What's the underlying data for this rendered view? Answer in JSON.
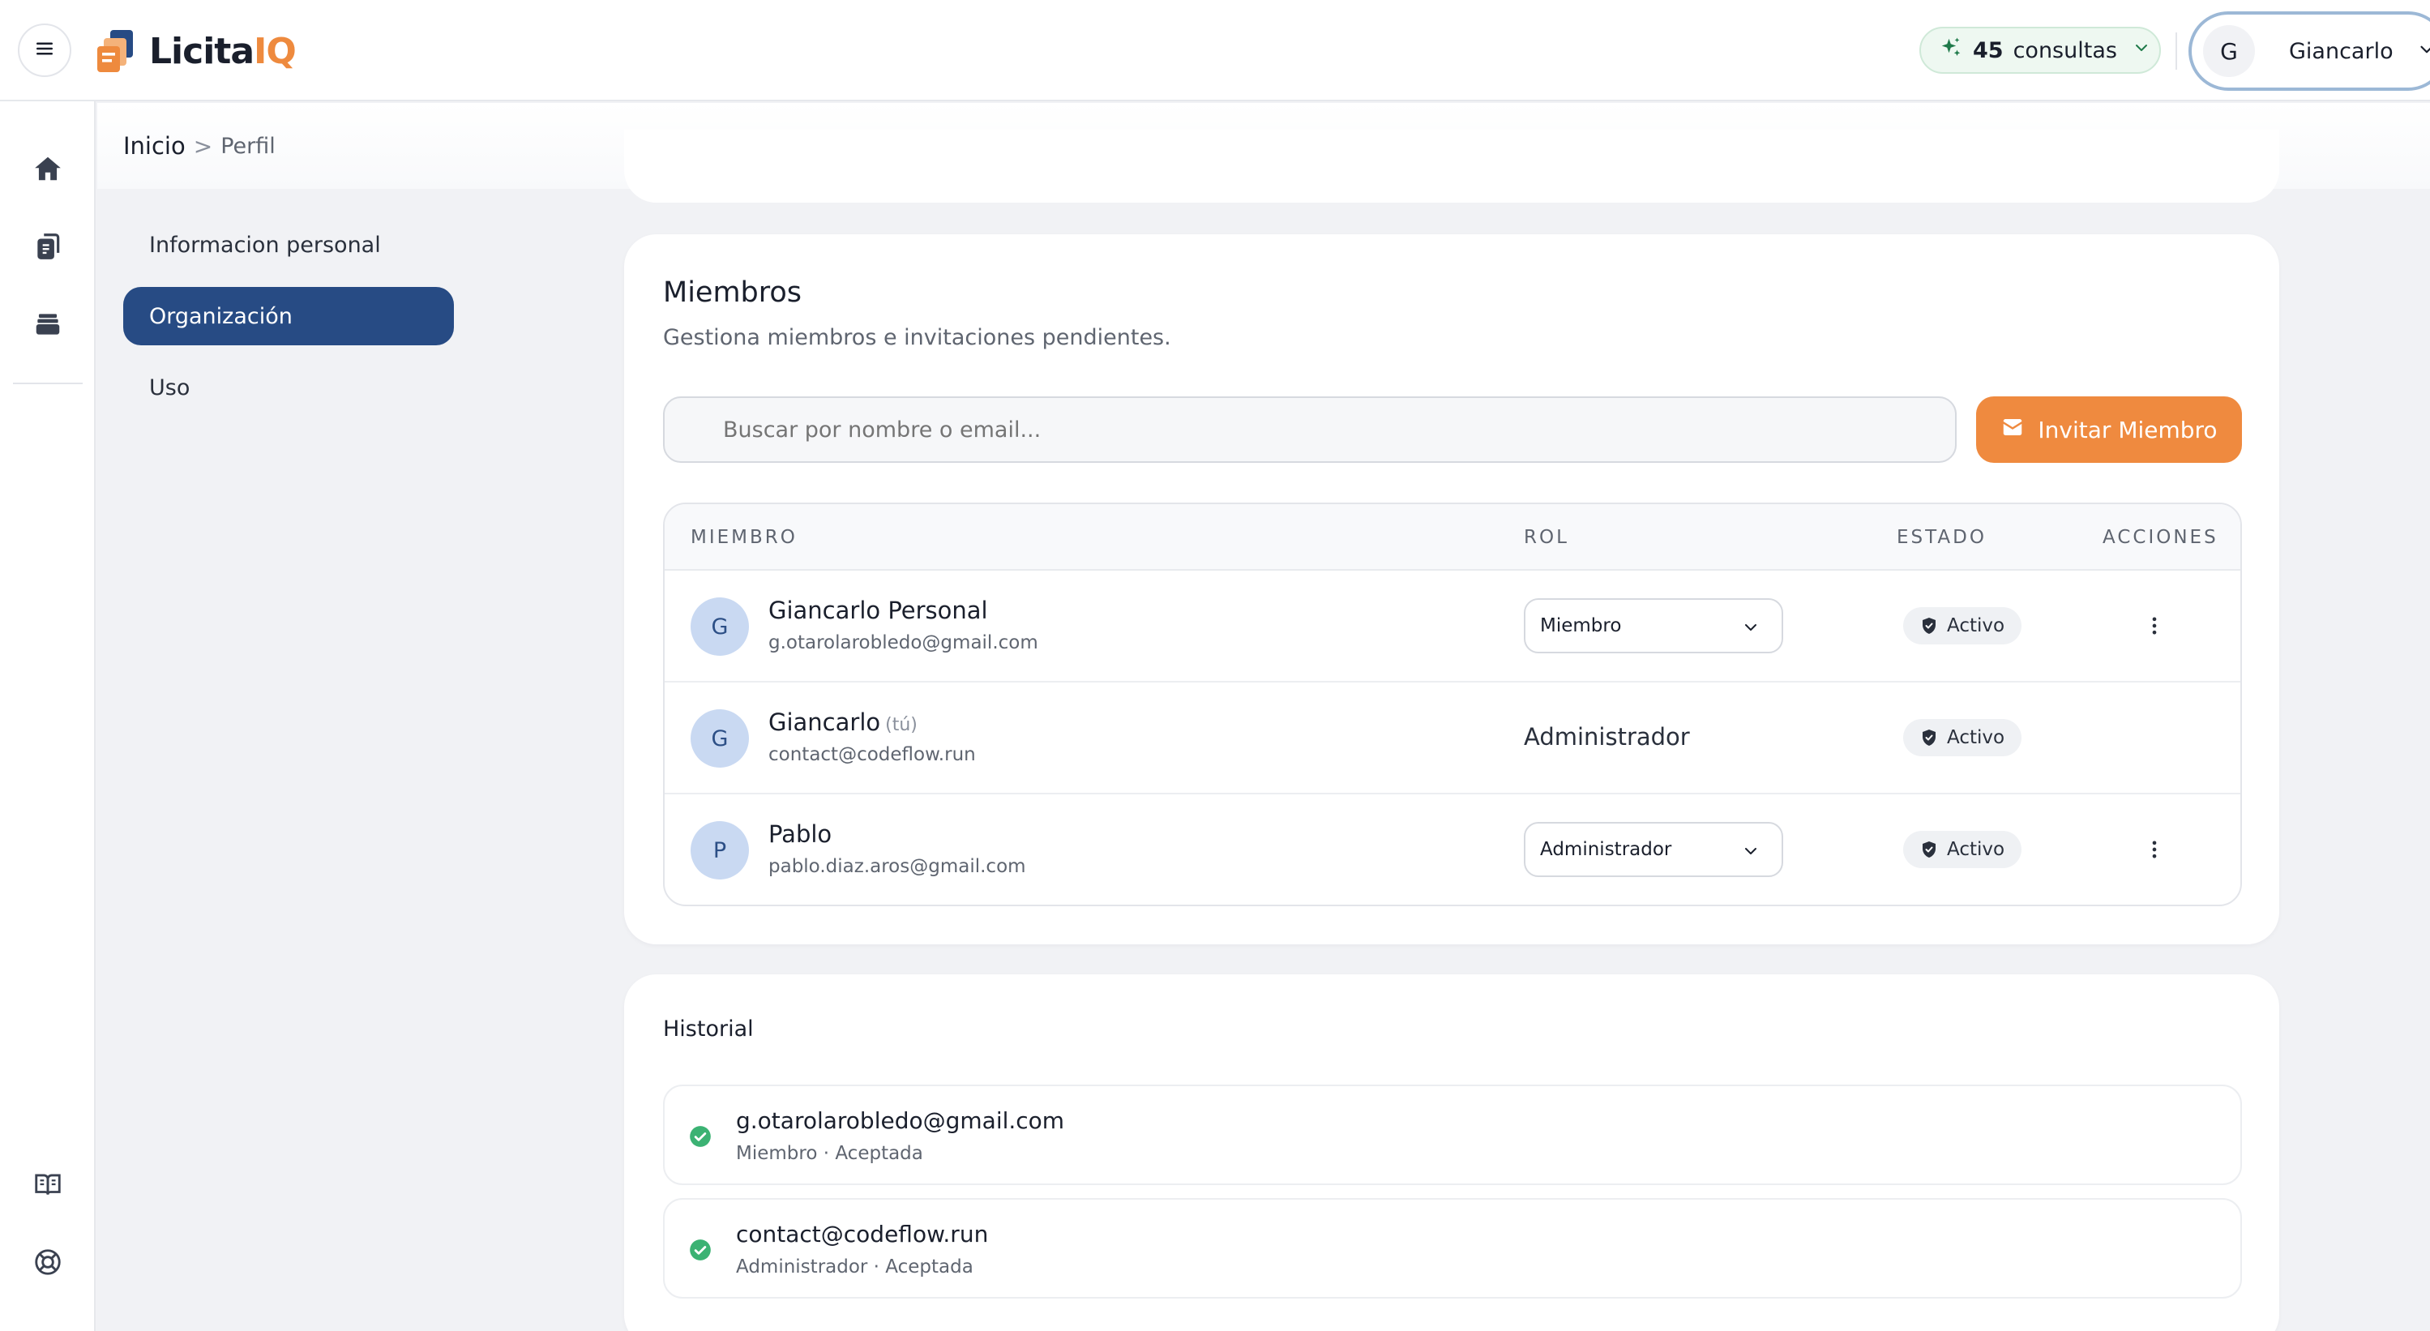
{
  "header": {
    "logo_prefix": "Licita",
    "logo_suffix": "IQ",
    "consultas_count": "45",
    "consultas_label": "consultas",
    "user_initial": "G",
    "user_name": "Giancarlo"
  },
  "breadcrumb": {
    "home": "Inicio",
    "separator": ">",
    "current": "Perfil"
  },
  "section_nav": [
    {
      "label": "Informacion personal",
      "active": false
    },
    {
      "label": "Organización",
      "active": true
    },
    {
      "label": "Uso",
      "active": false
    }
  ],
  "members": {
    "title": "Miembros",
    "subtitle": "Gestiona miembros e invitaciones pendientes.",
    "search_placeholder": "Buscar por nombre o email...",
    "invite_label": "Invitar Miembro",
    "columns": {
      "member": "MIEMBRO",
      "role": "ROL",
      "status": "ESTADO",
      "actions": "ACCIONES"
    },
    "rows": [
      {
        "initial": "G",
        "name": "Giancarlo Personal",
        "tag": "",
        "email": "g.otarolarobledo@gmail.com",
        "role": "Miembro",
        "editable": true,
        "status": "Activo"
      },
      {
        "initial": "G",
        "name": "Giancarlo",
        "tag": "(tú)",
        "email": "contact@codeflow.run",
        "role": "Administrador",
        "editable": false,
        "status": "Activo"
      },
      {
        "initial": "P",
        "name": "Pablo",
        "tag": "",
        "email": "pablo.diaz.aros@gmail.com",
        "role": "Administrador",
        "editable": true,
        "status": "Activo"
      }
    ]
  },
  "history": {
    "title": "Historial",
    "items": [
      {
        "email": "g.otarolarobledo@gmail.com",
        "meta": "Miembro · Aceptada"
      },
      {
        "email": "contact@codeflow.run",
        "meta": "Administrador · Aceptada"
      }
    ]
  },
  "colors": {
    "accent": "#ef8a3f",
    "primary": "#274b84",
    "success": "#3bb273"
  }
}
